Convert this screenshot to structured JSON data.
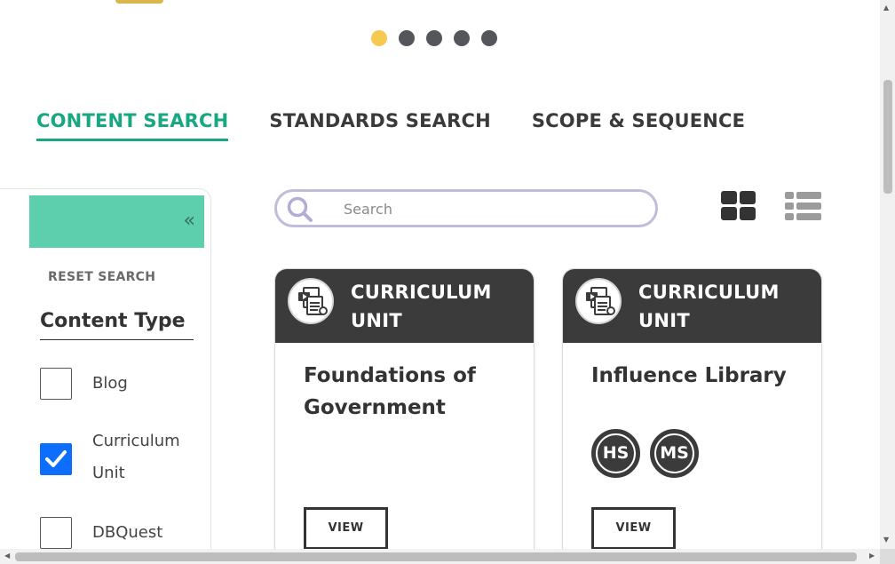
{
  "carousel": {
    "slide_count": 5,
    "active_index": 0,
    "active_color": "#f8c950",
    "inactive_color": "#55565c"
  },
  "tabs": [
    {
      "label": "CONTENT SEARCH",
      "active": true
    },
    {
      "label": "STANDARDS SEARCH",
      "active": false
    },
    {
      "label": "SCOPE & SEQUENCE",
      "active": false
    }
  ],
  "colors": {
    "accent": "#17a882",
    "collapse_bar": "#5ecfac",
    "card_header": "#3b3b3b",
    "checkbox_checked": "#0d6efd",
    "search_border": "#c2bcdc"
  },
  "sidebar": {
    "collapse_icon": "double-chevron-left-icon",
    "reset_label": "RESET SEARCH",
    "content_type_title": "Content Type",
    "filters": [
      {
        "label": "Blog",
        "checked": false
      },
      {
        "label": "Curriculum Unit",
        "checked": true
      },
      {
        "label": "DBQuest",
        "checked": false
      }
    ]
  },
  "search": {
    "placeholder": "Search",
    "value": ""
  },
  "view_toggle": {
    "grid_icon": "grid-view-icon",
    "list_icon": "list-view-icon"
  },
  "cards": [
    {
      "type": "CURRICULUM UNIT",
      "title": "Foundations of Government",
      "badges": [],
      "view_label": "VIEW"
    },
    {
      "type": "CURRICULUM UNIT",
      "title": "Influence Library",
      "badges": [
        "HS",
        "MS"
      ],
      "view_label": "VIEW"
    }
  ]
}
